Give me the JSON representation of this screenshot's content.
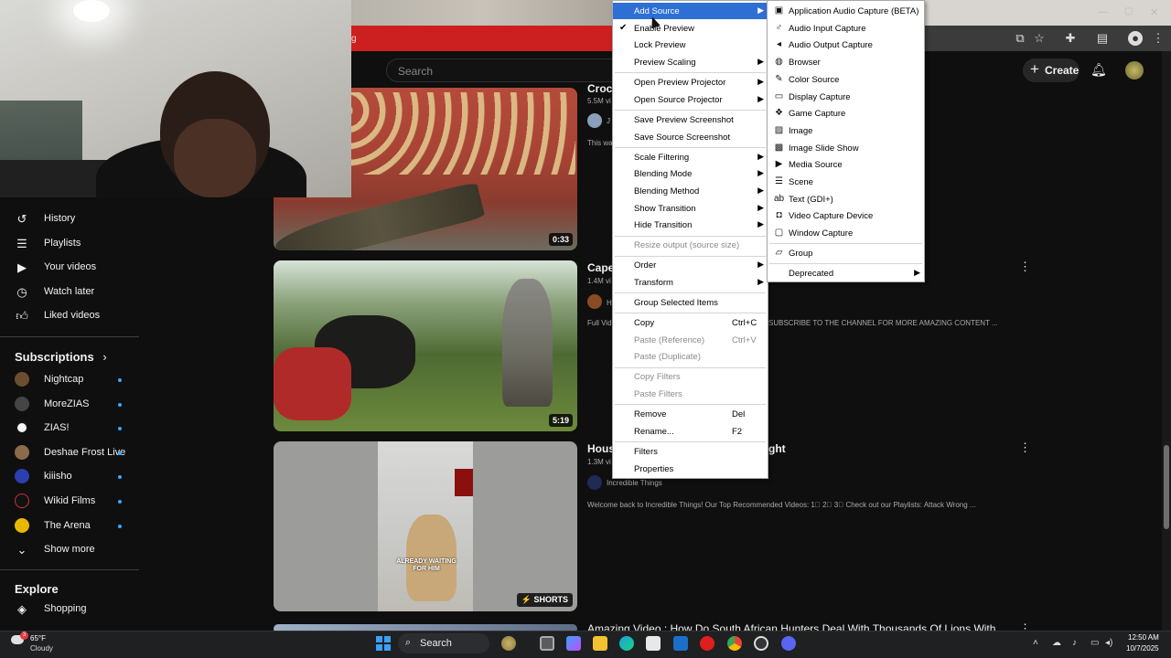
{
  "chrome": {
    "red_bar_fragment": "g"
  },
  "yt_header": {
    "search_placeholder": "Search",
    "create_label": "Create"
  },
  "sidebar": {
    "you_items": [
      {
        "label": "History",
        "icon": "history-icon"
      },
      {
        "label": "Playlists",
        "icon": "playlists-icon"
      },
      {
        "label": "Your videos",
        "icon": "your-videos-icon"
      },
      {
        "label": "Watch later",
        "icon": "watch-later-icon"
      },
      {
        "label": "Liked videos",
        "icon": "thumbs-up-icon"
      }
    ],
    "subscriptions_title": "Subscriptions",
    "subscriptions": [
      {
        "label": "Nightcap",
        "color": "#6b4e2e"
      },
      {
        "label": "MoreZIAS",
        "color": "#444444"
      },
      {
        "label": "ZIAS!",
        "color": "#f5f5f5"
      },
      {
        "label": "Deshae Frost Live",
        "color": "#8a6b4a"
      },
      {
        "label": "kiiisho",
        "color": "#2b3fb0"
      },
      {
        "label": "Wikid Films",
        "color": "#111111"
      },
      {
        "label": "The Arena",
        "color": "#e8b800"
      }
    ],
    "show_more": "Show more",
    "explore_title": "Explore",
    "explore_items": [
      {
        "label": "Shopping",
        "icon": "shopping-bag-icon"
      }
    ]
  },
  "videos": [
    {
      "title": "Croco",
      "meta": "5.5M vi",
      "channel_initial": "J",
      "desc": "This wa",
      "duration": "0:33"
    },
    {
      "title": "Cape",
      "meta": "1.4M vi",
      "channel_initial": "H",
      "desc": "Full Vid",
      "desc_tail": "SUBSCRIBE TO THE CHANNEL FOR MORE AMAZING CONTENT ...",
      "duration": "5:19"
    },
    {
      "title": "Hous",
      "title_tail": "ght",
      "meta": "1.3M vi",
      "channel": "Incredible Things",
      "desc": "Welcome back to Incredible Things! Our Top Recommended Videos: 1⃣ 2⃣ 3⃣ Check out our Playlists: Attack Wrong ...",
      "shorts_label": "SHORTS",
      "caption_1": "ALREADY WAITING",
      "caption_2": "FOR HIM"
    },
    {
      "title": "Amazing Video : How Do South African Hunters Deal With Thousands Of Lions With"
    }
  ],
  "context_menu": {
    "items": [
      {
        "label": "Add Source",
        "submenu": true,
        "highlighted": true
      },
      {
        "label": "Enable Preview",
        "checked": true
      },
      {
        "label": "Lock Preview"
      },
      {
        "label": "Preview Scaling",
        "submenu": true
      },
      {
        "sep": true
      },
      {
        "label": "Open Preview Projector",
        "submenu": true
      },
      {
        "label": "Open Source Projector",
        "submenu": true
      },
      {
        "sep": true
      },
      {
        "label": "Save Preview Screenshot"
      },
      {
        "label": "Save Source Screenshot"
      },
      {
        "sep": true
      },
      {
        "label": "Scale Filtering",
        "submenu": true
      },
      {
        "label": "Blending Mode",
        "submenu": true
      },
      {
        "label": "Blending Method",
        "submenu": true
      },
      {
        "label": "Show Transition",
        "submenu": true
      },
      {
        "label": "Hide Transition",
        "submenu": true
      },
      {
        "sep": true
      },
      {
        "label": "Resize output (source size)",
        "disabled": true
      },
      {
        "sep": true
      },
      {
        "label": "Order",
        "submenu": true
      },
      {
        "label": "Transform",
        "submenu": true
      },
      {
        "sep": true
      },
      {
        "label": "Group Selected Items"
      },
      {
        "sep": true
      },
      {
        "label": "Copy",
        "shortcut": "Ctrl+C"
      },
      {
        "label": "Paste (Reference)",
        "shortcut": "Ctrl+V",
        "disabled": true
      },
      {
        "label": "Paste (Duplicate)",
        "disabled": true
      },
      {
        "sep": true
      },
      {
        "label": "Copy Filters",
        "disabled": true
      },
      {
        "label": "Paste Filters",
        "disabled": true
      },
      {
        "sep": true
      },
      {
        "label": "Remove",
        "shortcut": "Del"
      },
      {
        "label": "Rename...",
        "shortcut": "F2"
      },
      {
        "sep": true
      },
      {
        "label": "Filters"
      },
      {
        "label": "Properties"
      }
    ]
  },
  "add_source_menu": {
    "items": [
      {
        "label": "Application Audio Capture (BETA)",
        "icon": "app-audio-icon",
        "glyph": "▣"
      },
      {
        "label": "Audio Input Capture",
        "icon": "microphone-icon",
        "glyph": "♂"
      },
      {
        "label": "Audio Output Capture",
        "icon": "speaker-icon",
        "glyph": "◂"
      },
      {
        "label": "Browser",
        "icon": "globe-icon",
        "glyph": "◍"
      },
      {
        "label": "Color Source",
        "icon": "paintbrush-icon",
        "glyph": "✎"
      },
      {
        "label": "Display Capture",
        "icon": "monitor-icon",
        "glyph": "▭"
      },
      {
        "label": "Game Capture",
        "icon": "gamepad-icon",
        "glyph": "❖"
      },
      {
        "label": "Image",
        "icon": "image-icon",
        "glyph": "▨"
      },
      {
        "label": "Image Slide Show",
        "icon": "slideshow-icon",
        "glyph": "▩"
      },
      {
        "label": "Media Source",
        "icon": "play-icon",
        "glyph": "▶"
      },
      {
        "label": "Scene",
        "icon": "list-icon",
        "glyph": "☰"
      },
      {
        "label": "Text (GDI+)",
        "icon": "text-icon",
        "glyph": "ab"
      },
      {
        "label": "Video Capture Device",
        "icon": "camera-icon",
        "glyph": "◘"
      },
      {
        "label": "Window Capture",
        "icon": "window-icon",
        "glyph": "▢"
      },
      {
        "sep": true
      },
      {
        "label": "Group",
        "icon": "folder-icon",
        "glyph": "▱"
      },
      {
        "sep": true
      },
      {
        "label": "Deprecated",
        "submenu": true
      }
    ]
  },
  "taskbar": {
    "weather_temp": "65°F",
    "weather_cond": "Cloudy",
    "weather_badge": "3",
    "search_label": "Search",
    "time": "12:50 AM",
    "date": "10/7/2025"
  }
}
